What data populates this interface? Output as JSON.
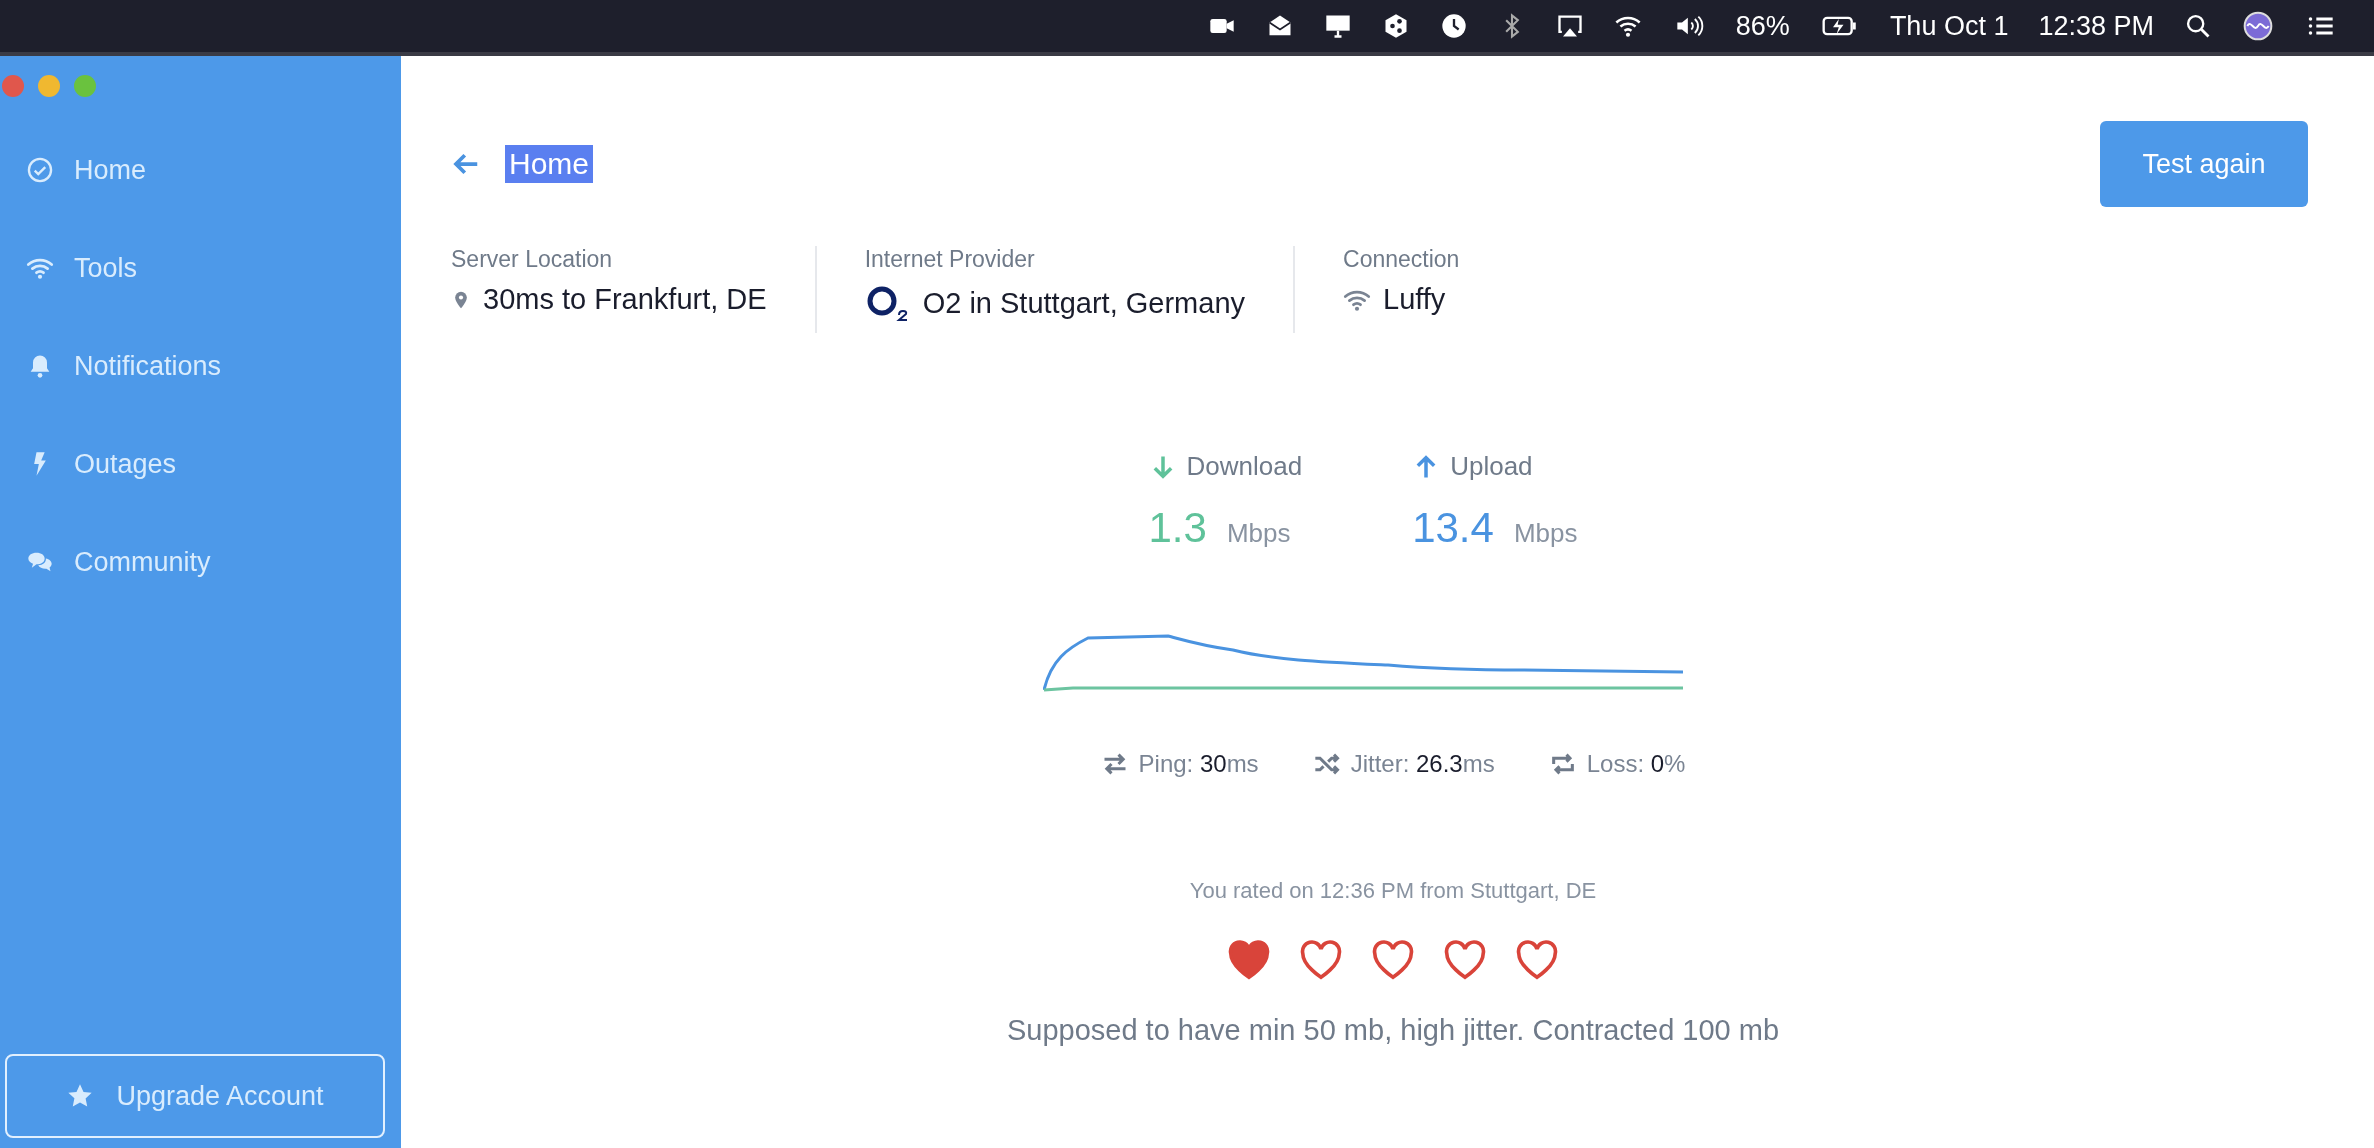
{
  "menu_bar": {
    "battery": "86%",
    "date": "Thu Oct 1",
    "time": "12:38 PM"
  },
  "sidebar": {
    "items": [
      {
        "label": "Home"
      },
      {
        "label": "Tools"
      },
      {
        "label": "Notifications"
      },
      {
        "label": "Outages"
      },
      {
        "label": "Community"
      }
    ],
    "upgrade_button": "Upgrade Account"
  },
  "header": {
    "title": "Home",
    "title_highlighted": true,
    "button": "Test again"
  },
  "info": [
    {
      "label": "Server Location",
      "value": "30ms to Frankfurt, DE"
    },
    {
      "label": "Internet Provider",
      "value": "O2 in Stuttgart, Germany"
    },
    {
      "label": "Connection",
      "value": "Luffy"
    }
  ],
  "speeds": [
    {
      "kind": "download",
      "label": "Download",
      "value": "1.3",
      "unit": "Mbps"
    },
    {
      "kind": "upload",
      "label": "Upload",
      "value": "13.4",
      "unit": "Mbps"
    }
  ],
  "stats": [
    {
      "label": "Ping:",
      "value": "30",
      "unit": "ms"
    },
    {
      "label": "Jitter:",
      "value": "26.3",
      "unit": "ms"
    },
    {
      "label": "Loss:",
      "value": "0",
      "unit": "%"
    }
  ],
  "rating": {
    "caption": "You rated on 12:36 PM from Stuttgart, DE",
    "stars": 1,
    "comment": "Supposed to have min 50 mb, high jitter. Contracted 100 mb"
  }
}
